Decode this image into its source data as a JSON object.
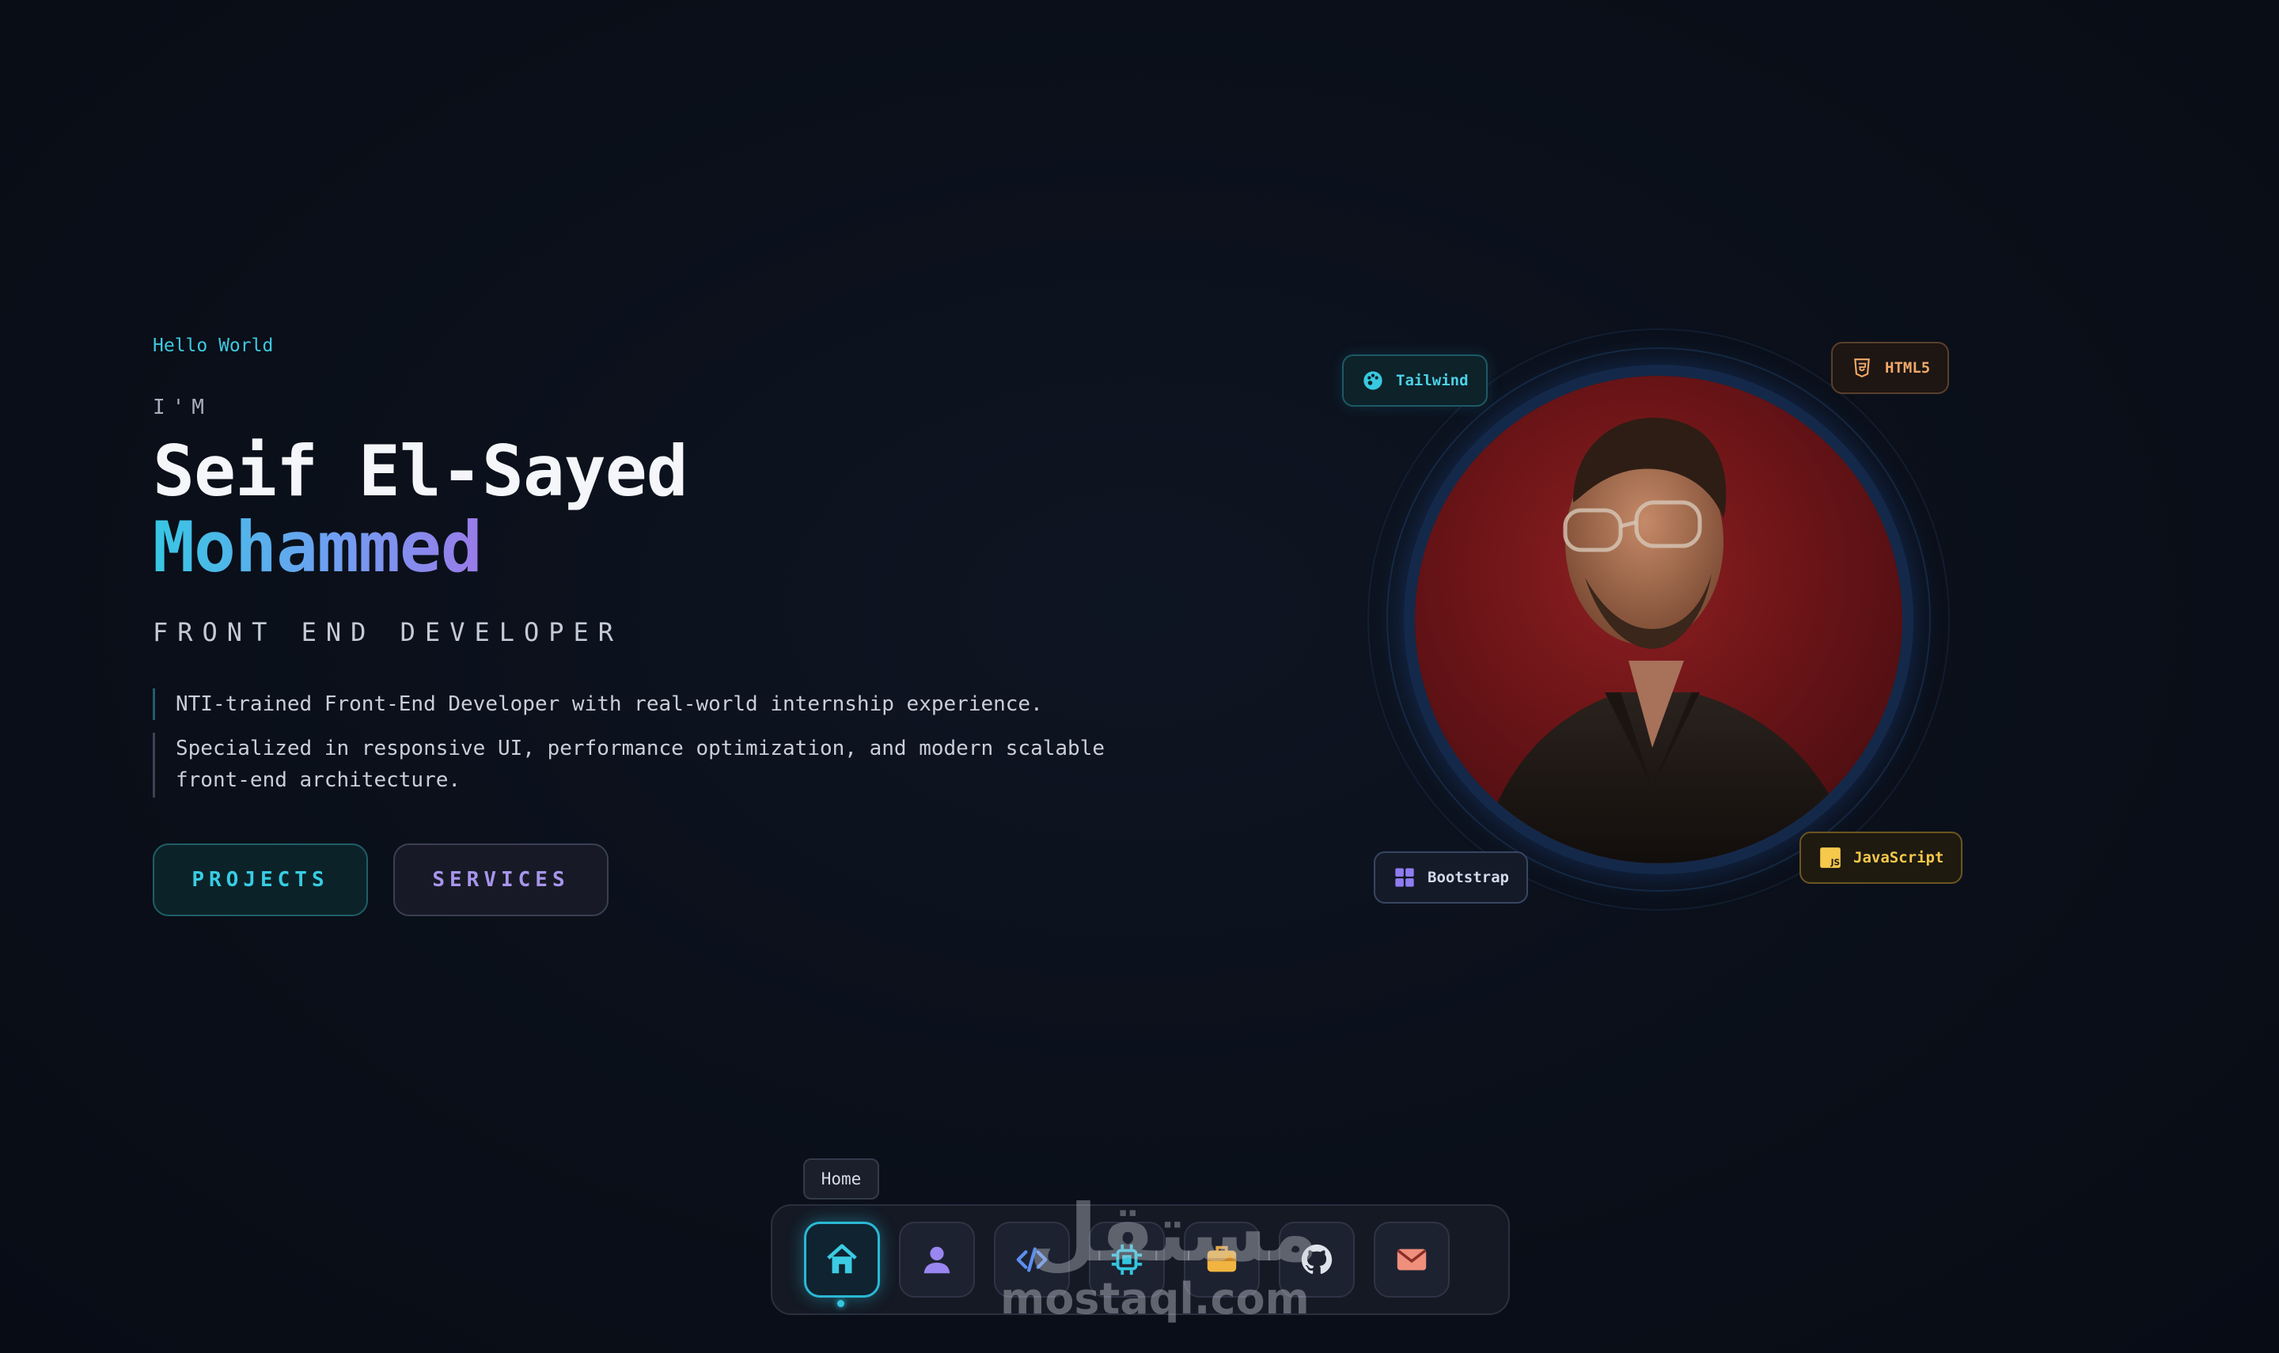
{
  "hero": {
    "greeting": "Hello World",
    "intro": "I'M",
    "first_name": "Seif El-Sayed",
    "last_name": "Mohammed",
    "role": "FRONT END DEVELOPER",
    "description": [
      "NTI-trained Front-End Developer with real-world internship experience.",
      "Specialized in responsive UI, performance optimization, and modern scalable front-end architecture."
    ],
    "buttons": {
      "projects": "PROJECTS",
      "services": "SERVICES"
    }
  },
  "tech_chips": [
    {
      "label": "Tailwind",
      "icon": "palette-icon",
      "color": "#4cd0e6"
    },
    {
      "label": "HTML5",
      "icon": "html5-icon",
      "color": "#f0a86a"
    },
    {
      "label": "Bootstrap",
      "icon": "grid-icon",
      "color": "#8f7cf0"
    },
    {
      "label": "JavaScript",
      "icon": "js-icon",
      "color": "#f6c84b"
    }
  ],
  "dock": {
    "tooltip": "Home",
    "items": [
      {
        "name": "home",
        "icon": "home-icon",
        "active": true
      },
      {
        "name": "about",
        "icon": "user-icon"
      },
      {
        "name": "skills",
        "icon": "code-icon"
      },
      {
        "name": "tech",
        "icon": "chip-icon"
      },
      {
        "name": "experience",
        "icon": "briefcase-icon"
      },
      {
        "name": "github",
        "icon": "github-icon"
      },
      {
        "name": "contact",
        "icon": "mail-icon"
      }
    ]
  },
  "watermark": {
    "arabic": "مستقل",
    "latin": "mostaql.com"
  },
  "colors": {
    "accent_cyan": "#38cde3",
    "accent_purple": "#a895ec",
    "background": "#0b111c"
  }
}
